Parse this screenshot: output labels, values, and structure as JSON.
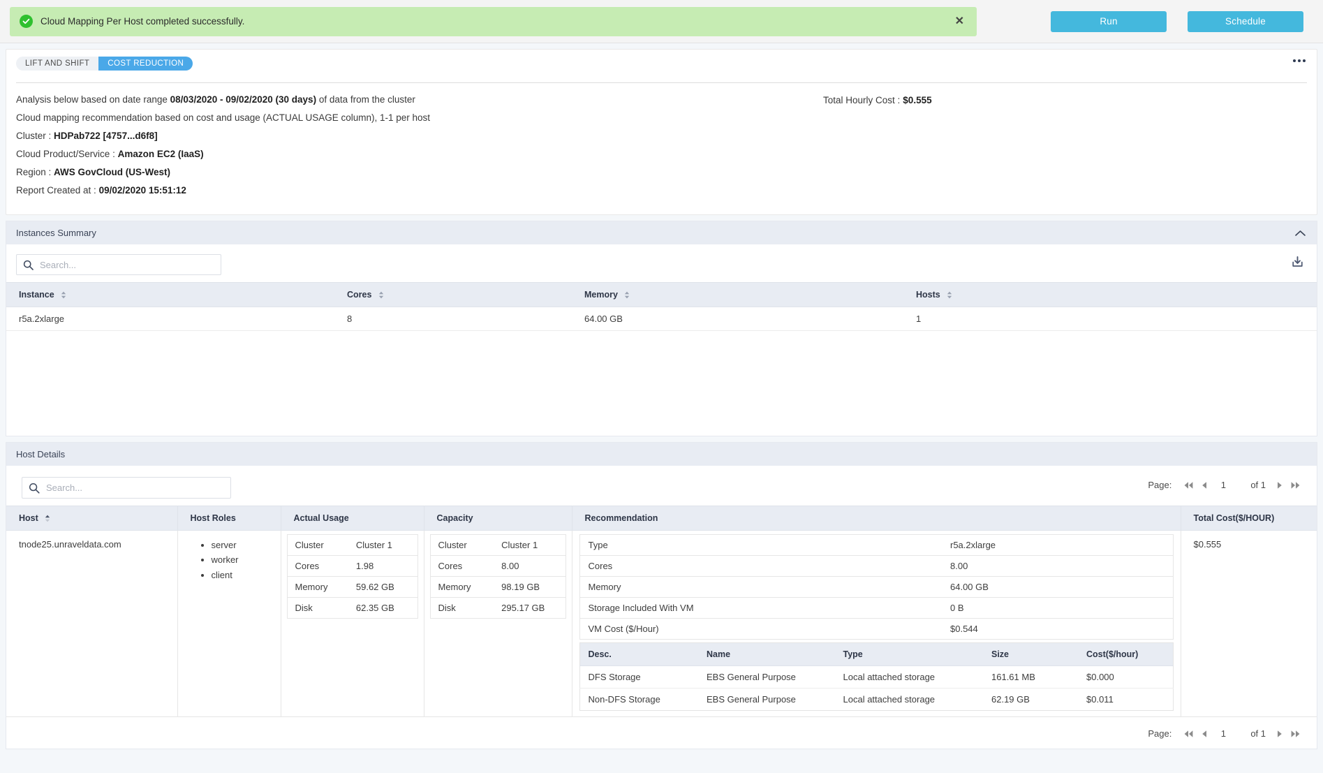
{
  "alert": {
    "message": "Cloud Mapping Per Host completed successfully.",
    "close_label": "✕",
    "icon": "check-circle-icon",
    "bg_color": "#c6ecb3",
    "icon_color": "#2fc02f"
  },
  "toolbar": {
    "run_label": "Run",
    "schedule_label": "Schedule",
    "accent_color": "#44b8dd"
  },
  "tabs": [
    {
      "label": "LIFT AND SHIFT",
      "active": false
    },
    {
      "label": "COST REDUCTION",
      "active": true
    }
  ],
  "kebab_menu": {
    "name": "more-options-icon"
  },
  "info": {
    "line1_prefix": "Analysis below based on date range ",
    "line1_range": "08/03/2020 - 09/02/2020 (30 days)",
    "line1_suffix": " of data from the cluster",
    "line2": "Cloud mapping recommendation based on cost and usage (ACTUAL USAGE column), 1-1 per host",
    "cluster_label": "Cluster : ",
    "cluster_value": "HDPab722 [4757...d6f8]",
    "product_label": "Cloud Product/Service : ",
    "product_value": "Amazon EC2 (IaaS)",
    "region_label": "Region : ",
    "region_value": "AWS GovCloud (US-West)",
    "created_label": "Report Created at : ",
    "created_value": "09/02/2020 15:51:12",
    "total_cost_label": "Total Hourly Cost :",
    "total_cost_value": "$0.555"
  },
  "instances_summary": {
    "title": "Instances Summary",
    "search_placeholder": "Search...",
    "download_label": "download-icon",
    "columns": [
      "Instance",
      "Cores",
      "Memory",
      "Hosts"
    ],
    "rows": [
      {
        "instance": "r5a.2xlarge",
        "cores": "8",
        "memory": "64.00 GB",
        "hosts": "1"
      }
    ]
  },
  "host_details": {
    "title": "Host Details",
    "search_placeholder": "Search...",
    "columns": [
      "Host",
      "Host Roles",
      "Actual Usage",
      "Capacity",
      "Recommendation",
      "Total Cost($/HOUR)"
    ],
    "pager": {
      "label": "Page:",
      "current": "1",
      "of": "of 1",
      "first_icon": "first-page-icon",
      "prev_icon": "prev-page-icon",
      "next_icon": "next-page-icon",
      "last_icon": "last-page-icon"
    },
    "row": {
      "host": "tnode25.unraveldata.com",
      "roles": [
        "server",
        "worker",
        "client"
      ],
      "actual_usage": [
        {
          "k": "Cluster",
          "v": "Cluster 1"
        },
        {
          "k": "Cores",
          "v": "1.98"
        },
        {
          "k": "Memory",
          "v": "59.62 GB"
        },
        {
          "k": "Disk",
          "v": "62.35 GB"
        }
      ],
      "capacity": [
        {
          "k": "Cluster",
          "v": "Cluster 1"
        },
        {
          "k": "Cores",
          "v": "8.00"
        },
        {
          "k": "Memory",
          "v": "98.19 GB"
        },
        {
          "k": "Disk",
          "v": "295.17 GB"
        }
      ],
      "recommendation": [
        {
          "k": "Type",
          "v": "r5a.2xlarge"
        },
        {
          "k": "Cores",
          "v": "8.00"
        },
        {
          "k": "Memory",
          "v": "64.00 GB"
        },
        {
          "k": "Storage Included With VM",
          "v": "0 B"
        },
        {
          "k": "VM Cost ($/Hour)",
          "v": "$0.544"
        }
      ],
      "storage_columns": [
        "Desc.",
        "Name",
        "Type",
        "Size",
        "Cost($/hour)"
      ],
      "storage_rows": [
        {
          "desc": "DFS Storage",
          "name": "EBS General Purpose",
          "type": "Local attached storage",
          "size": "161.61 MB",
          "cost": "$0.000"
        },
        {
          "desc": "Non-DFS Storage",
          "name": "EBS General Purpose",
          "type": "Local attached storage",
          "size": "62.19 GB",
          "cost": "$0.011"
        }
      ],
      "total_cost": "$0.555"
    }
  }
}
